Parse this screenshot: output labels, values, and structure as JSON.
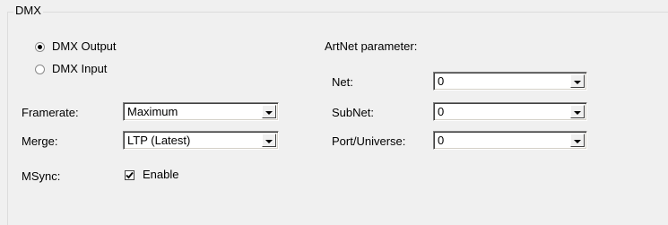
{
  "group": {
    "title": "DMX"
  },
  "mode": {
    "output_label": "DMX Output",
    "input_label": "DMX Input",
    "selected": "DMX Output"
  },
  "framerate": {
    "label": "Framerate:",
    "value": "Maximum"
  },
  "merge": {
    "label": "Merge:",
    "value": "LTP (Latest)"
  },
  "msync": {
    "label": "MSync:",
    "checkbox_label": "Enable",
    "checked": true
  },
  "artnet": {
    "heading": "ArtNet parameter:",
    "net": {
      "label": "Net:",
      "value": "0"
    },
    "subnet": {
      "label": "SubNet:",
      "value": "0"
    },
    "port_universe": {
      "label": "Port/Universe:",
      "value": "0"
    }
  }
}
